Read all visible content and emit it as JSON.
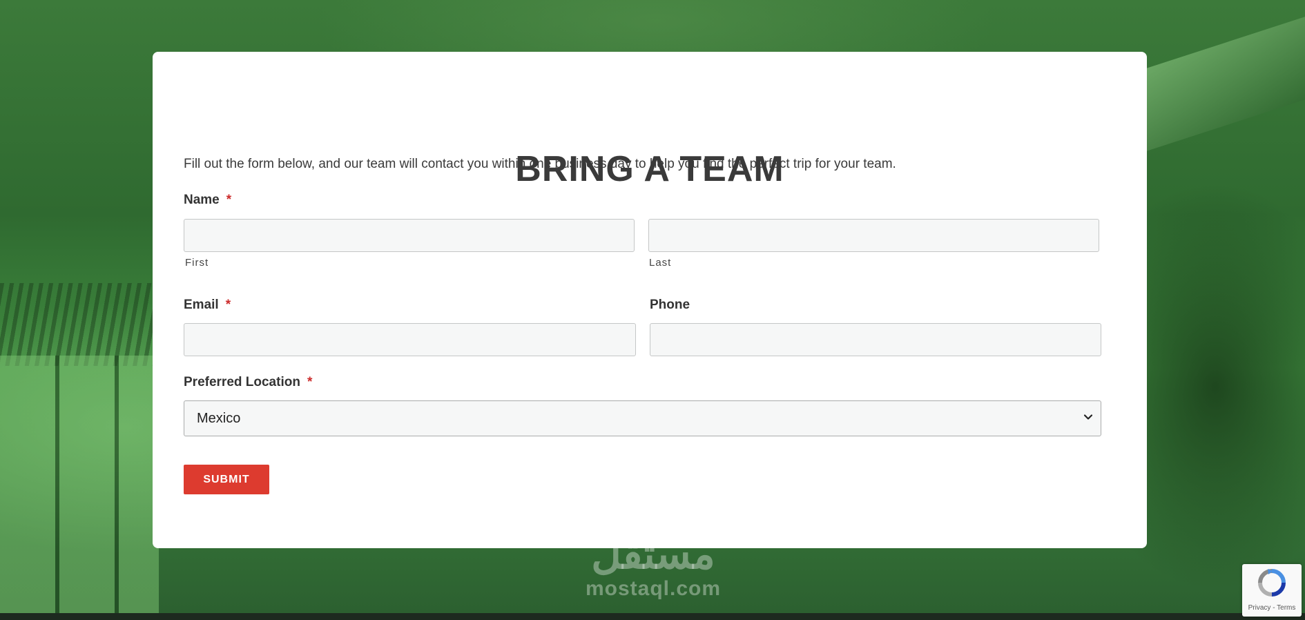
{
  "form": {
    "title": "BRING A TEAM",
    "intro": "Fill out the form below, and our team will contact you within one business day to help you find the perfect trip for your team.",
    "name_label": "Name",
    "required_marker": "*",
    "first_sublabel": "First",
    "last_sublabel": "Last",
    "first_value": "",
    "last_value": "",
    "email_label": "Email",
    "email_value": "",
    "phone_label": "Phone",
    "phone_value": "",
    "location_label": "Preferred Location",
    "location_selected": "Mexico",
    "submit_label": "SUBMIT"
  },
  "watermark": {
    "arabic": "مستقل",
    "latin": "mostaql.com"
  },
  "recaptcha": {
    "privacy": "Privacy",
    "separator": " - ",
    "terms": "Terms"
  },
  "icons": {
    "select_chevron": "chevron-down-icon",
    "recaptcha_logo": "recaptcha-icon"
  },
  "colors": {
    "required": "#cc2b2b",
    "submit_bg": "#dd3b2f",
    "card_bg": "#ffffff",
    "input_bg": "#f6f7f7",
    "background_tint": "#2e6b32"
  }
}
